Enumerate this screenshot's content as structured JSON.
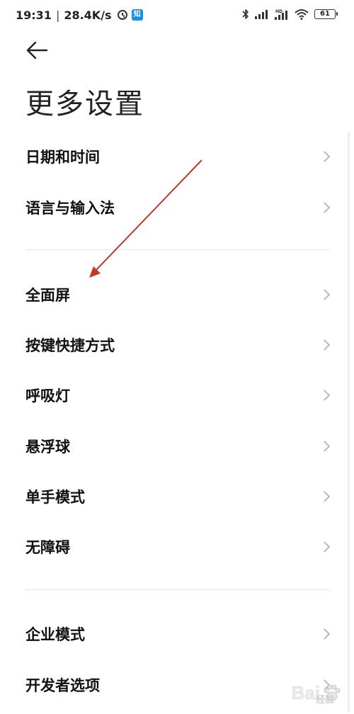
{
  "status_bar": {
    "time": "19:31",
    "net_speed": "28.4K/s",
    "app_badge": "知",
    "battery": "61"
  },
  "header": {
    "title": "更多设置"
  },
  "settings": {
    "group1": [
      {
        "label": "日期和时间"
      },
      {
        "label": "语言与输入法"
      }
    ],
    "group2": [
      {
        "label": "全面屏"
      },
      {
        "label": "按键快捷方式"
      },
      {
        "label": "呼吸灯"
      },
      {
        "label": "悬浮球"
      },
      {
        "label": "单手模式"
      },
      {
        "label": "无障碍"
      }
    ],
    "group3": [
      {
        "label": "企业模式"
      },
      {
        "label": "开发者选项"
      }
    ]
  },
  "annotation": {
    "color": "#c0392b"
  },
  "watermark": {
    "text": "Bai",
    "sub": "经验"
  }
}
